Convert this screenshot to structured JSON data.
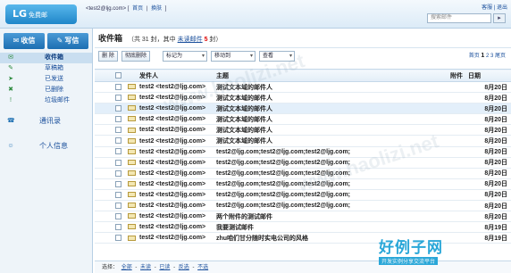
{
  "header": {
    "logo_text": "LG",
    "logo_sub": "免费邮",
    "user_email": "<test2@ljg.com>",
    "user_links": [
      "首页",
      "换肤"
    ],
    "top_links": [
      "客服",
      "退出"
    ],
    "search_placeholder": "搜索邮件",
    "search_button": "▸"
  },
  "sidebar": {
    "receive_btn": "收信",
    "compose_btn": "写信",
    "items": [
      {
        "label": "收件箱",
        "icon": "inbox-icon",
        "glyph": "✉",
        "active": true
      },
      {
        "label": "草稿箱",
        "icon": "draft-icon",
        "glyph": "✎",
        "active": false
      },
      {
        "label": "已发送",
        "icon": "sent-icon",
        "glyph": "➤",
        "active": false
      },
      {
        "label": "已删除",
        "icon": "trash-icon",
        "glyph": "✖",
        "active": false
      },
      {
        "label": "垃圾邮件",
        "icon": "spam-icon",
        "glyph": "!",
        "active": false
      }
    ],
    "groups": [
      {
        "label": "通讯录",
        "icon": "contacts-icon",
        "glyph": "☎"
      },
      {
        "label": "个人信息",
        "icon": "profile-icon",
        "glyph": "☺"
      }
    ]
  },
  "main": {
    "title": "收件箱",
    "stat_total": "（共 31 封，其中",
    "stat_unread_link": "未读邮件",
    "stat_unread_count": "5",
    "stat_suffix": "封）",
    "toolbar": {
      "delete": "删 除",
      "perm_delete": "彻底删除",
      "mark_as": "标记为",
      "move_to": "移动到",
      "view": "查看"
    },
    "pager": {
      "first": "首页",
      "pages": [
        "1",
        "2",
        "3"
      ],
      "current": "1",
      "next": "尾页"
    },
    "columns": {
      "sender": "发件人",
      "subject": "主题",
      "attach": "附件",
      "date": "日期"
    },
    "rows": [
      {
        "sender": "test2 <test2@ljg.com>",
        "subject": "测试文本域的邮件人",
        "date": "8月20日",
        "hl": false
      },
      {
        "sender": "test2 <test2@ljg.com>",
        "subject": "测试文本域的邮件人",
        "date": "8月20日",
        "hl": false
      },
      {
        "sender": "test2 <test2@ljg.com>",
        "subject": "测试文本域的邮件人",
        "date": "8月20日",
        "hl": true
      },
      {
        "sender": "test2 <test2@ljg.com>",
        "subject": "测试文本域的邮件人",
        "date": "8月20日",
        "hl": false
      },
      {
        "sender": "test2 <test2@ljg.com>",
        "subject": "测试文本域的邮件人",
        "date": "8月20日",
        "hl": false
      },
      {
        "sender": "test2 <test2@ljg.com>",
        "subject": "测试文本域的邮件人",
        "date": "8月20日",
        "hl": false
      },
      {
        "sender": "test2 <test2@ljg.com>",
        "subject": "test2@ljg.com;test2@ljg.com;test2@ljg.com;",
        "date": "8月20日",
        "hl": false
      },
      {
        "sender": "test2 <test2@ljg.com>",
        "subject": "test2@ljg.com;test2@ljg.com;test2@ljg.com;",
        "date": "8月20日",
        "hl": false
      },
      {
        "sender": "test2 <test2@ljg.com>",
        "subject": "test2@ljg.com;test2@ljg.com;test2@ljg.com;",
        "date": "8月20日",
        "hl": false
      },
      {
        "sender": "test2 <test2@ljg.com>",
        "subject": "test2@ljg.com;test2@ljg.com;test2@ljg.com;",
        "date": "8月20日",
        "hl": false
      },
      {
        "sender": "test2 <test2@ljg.com>",
        "subject": "test2@ljg.com;test2@ljg.com;test2@ljg.com;",
        "date": "8月20日",
        "hl": false
      },
      {
        "sender": "test2 <test2@ljg.com>",
        "subject": "test2@ljg.com;test2@ljg.com;test2@ljg.com;",
        "date": "8月20日",
        "hl": false
      },
      {
        "sender": "test2 <test2@ljg.com>",
        "subject": "两个附件的测试邮件",
        "date": "8月20日",
        "hl": false
      },
      {
        "sender": "test2 <test2@ljg.com>",
        "subject": "我要测试邮件",
        "date": "8月19日",
        "hl": false
      },
      {
        "sender": "test2 <test2@ljg.com>",
        "subject": "zhu咱们甘分随时实电公司的风格",
        "date": "8月19日",
        "hl": false
      }
    ],
    "footer": {
      "label": "选择：",
      "links": [
        "全部",
        "未读",
        "已读",
        "反选",
        "不选"
      ]
    }
  },
  "watermarks": {
    "brand_big": "好例子网",
    "brand_small": "开发实例分享交流平台",
    "site": "www.haolizi.net"
  },
  "colors": {
    "accent": "#1d6fb2",
    "link": "#1a4f9c",
    "highlight_row": "#e3effa",
    "unread_red": "#dd0000"
  }
}
